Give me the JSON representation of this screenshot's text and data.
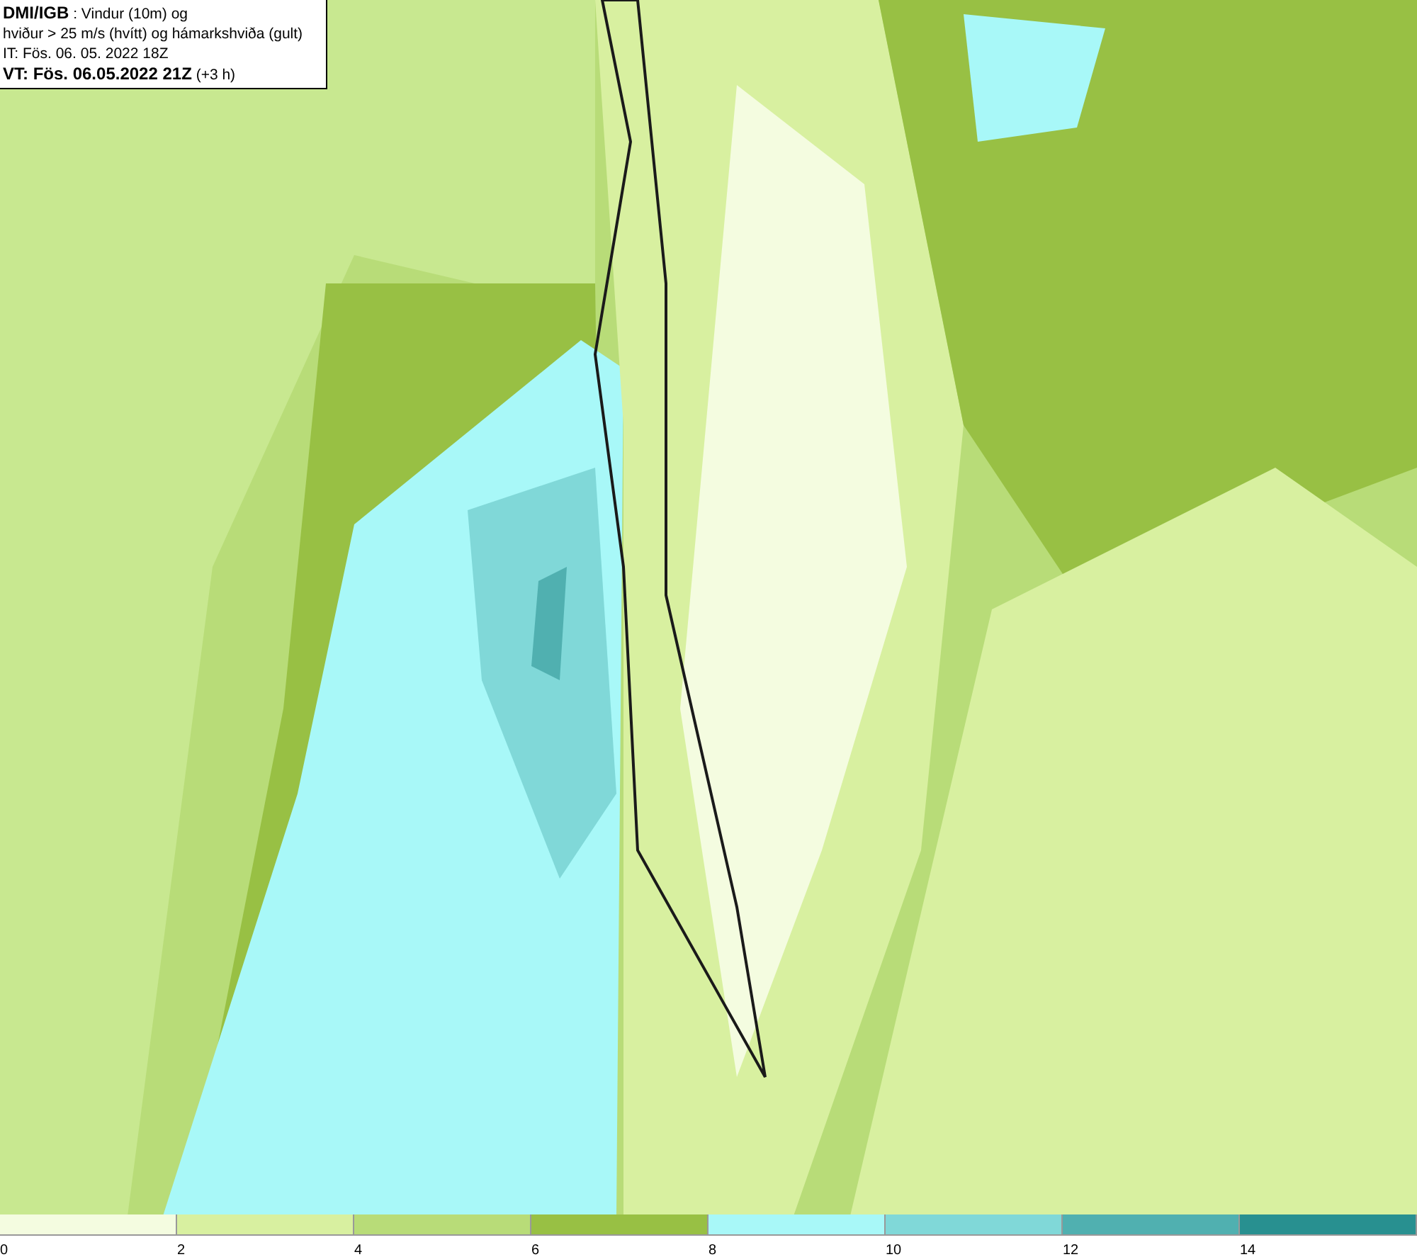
{
  "header": {
    "lines": [
      "**DMI/IGB** : Vindur (10m) og",
      "hviður > 25 m/s (hvítt) og hámarkshviða (gult)",
      "IT: Fös. 06. 05. 2022 18Z",
      "**VT: Fös. 06.05.2022 21Z** (+3 h)"
    ]
  },
  "legend": {
    "bins": [
      {
        "color": "#f4fce0"
      },
      {
        "color": "#d8f0a0"
      },
      {
        "color": "#b8dc78"
      },
      {
        "color": "#98c044"
      },
      {
        "color": "#a8f8f8"
      },
      {
        "color": "#80d8d8"
      },
      {
        "color": "#50b0b0"
      },
      {
        "color": "#289090"
      }
    ],
    "ticks": [
      "0",
      "2",
      "4",
      "6",
      "8",
      "10",
      "12",
      "14"
    ]
  }
}
